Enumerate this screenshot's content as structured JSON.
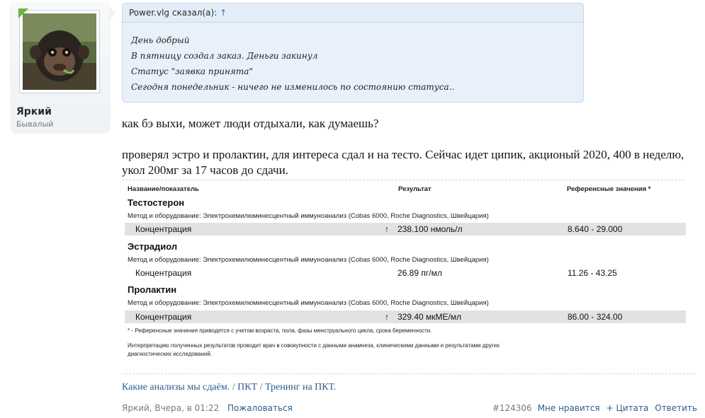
{
  "user": {
    "name": "Яркий",
    "title": "Бывалый"
  },
  "quote": {
    "author_line": "Power.vlg сказал(а):",
    "up_arrow": "↑",
    "lines": [
      "День добрый",
      "В пятницу создал заказ. Деньги закинул",
      "Статус \"заявка принята\"",
      "Сегодня понедельник - ничего не изменилось по состоянию статуса.."
    ]
  },
  "message": {
    "p1": "как бэ выхи, может люди отдыхали, как думаешь?",
    "p2": "проверял эстро и пролактин, для интереса сдал и на тесто. Сейчас идет ципик, акционый 2020, 400 в неделю, укол 200мг за 17 часов до сдачи."
  },
  "lab": {
    "headers": {
      "name": "Название/показатель",
      "result": "Результат",
      "reference": "Референсные значения *"
    },
    "tests": [
      {
        "name": "Тестостерон",
        "method": "Метод и оборудование:  Электрохемилюминесцентный иммуноанализ (Cobas 6000, Roche Diagnostics, Швейцария)",
        "row_label": "Концентрация",
        "arrow": "↑",
        "result": "238.100 нмоль/л",
        "reference": "8.640 - 29.000"
      },
      {
        "name": "Эстрадиол",
        "method": "Метод и оборудование:  Электрохемилюминесцентный иммуноанализ (Cobas 6000, Roche Diagnostics, Швейцария)",
        "row_label": "Концентрация",
        "arrow": "",
        "result": "26.89 пг/мл",
        "reference": "11.26 - 43.25"
      },
      {
        "name": "Пролактин",
        "method": "Метод и оборудование:  Электрохемилюминесцентный иммуноанализ (Cobas 6000, Roche Diagnostics, Швейцария)",
        "row_label": "Концентрация",
        "arrow": "↑",
        "result": "329.40 мкМЕ/мл",
        "reference": "86.00 - 324.00"
      }
    ],
    "footnote": "* - Референсные значения приводятся с учетом возраста, пола, фазы менструального цикла, срока беременности.",
    "interpretation_1": "Интерпретацию полученных результатов проводит врач в совокупности с данными анамнеза, клиническими данными и результатами других",
    "interpretation_2": "диагностических исследований."
  },
  "signature": {
    "link1": "Какие анализы мы сдаём.",
    "sep1": " / ",
    "link2": "ПКТ",
    "sep2": " / ",
    "link3": "Тренинг на ПКТ."
  },
  "footer": {
    "meta": "Яркий, Вчера, в 01:22",
    "report": "Пожаловаться",
    "post_number": "#124306",
    "like": "Мне нравится",
    "quote": "+ Цитата",
    "reply": "Ответить"
  },
  "colors": {
    "link": "#2e5d8c",
    "quote_bg": "#e8f1fa",
    "online": "#6cb33f"
  }
}
